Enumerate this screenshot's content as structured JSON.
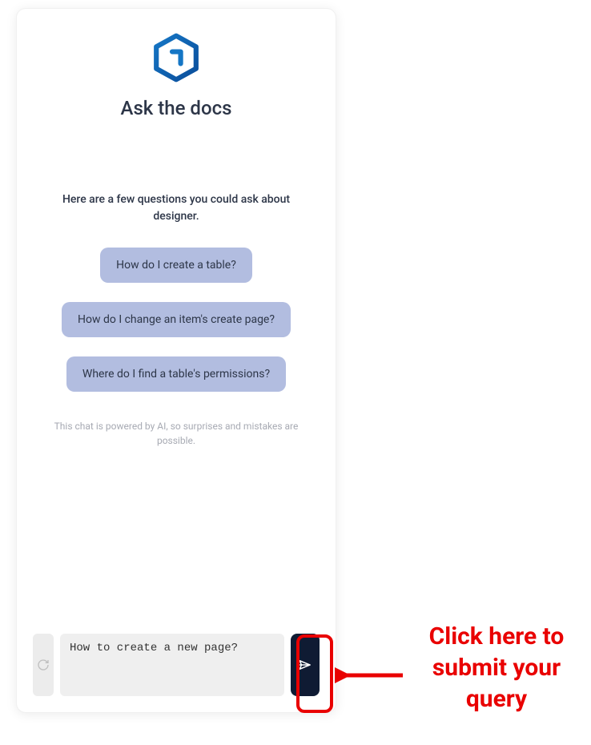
{
  "title": "Ask the docs",
  "intro": "Here are a few questions you could ask about designer.",
  "suggestions": [
    "How do I create a table?",
    "How do I change an item's create page?",
    "Where do I find a table's permissions?"
  ],
  "disclaimer": "This chat is powered by AI, so surprises and mistakes are possible.",
  "input_value": "How to create a new page?",
  "annotation": "Click here to submit your query"
}
